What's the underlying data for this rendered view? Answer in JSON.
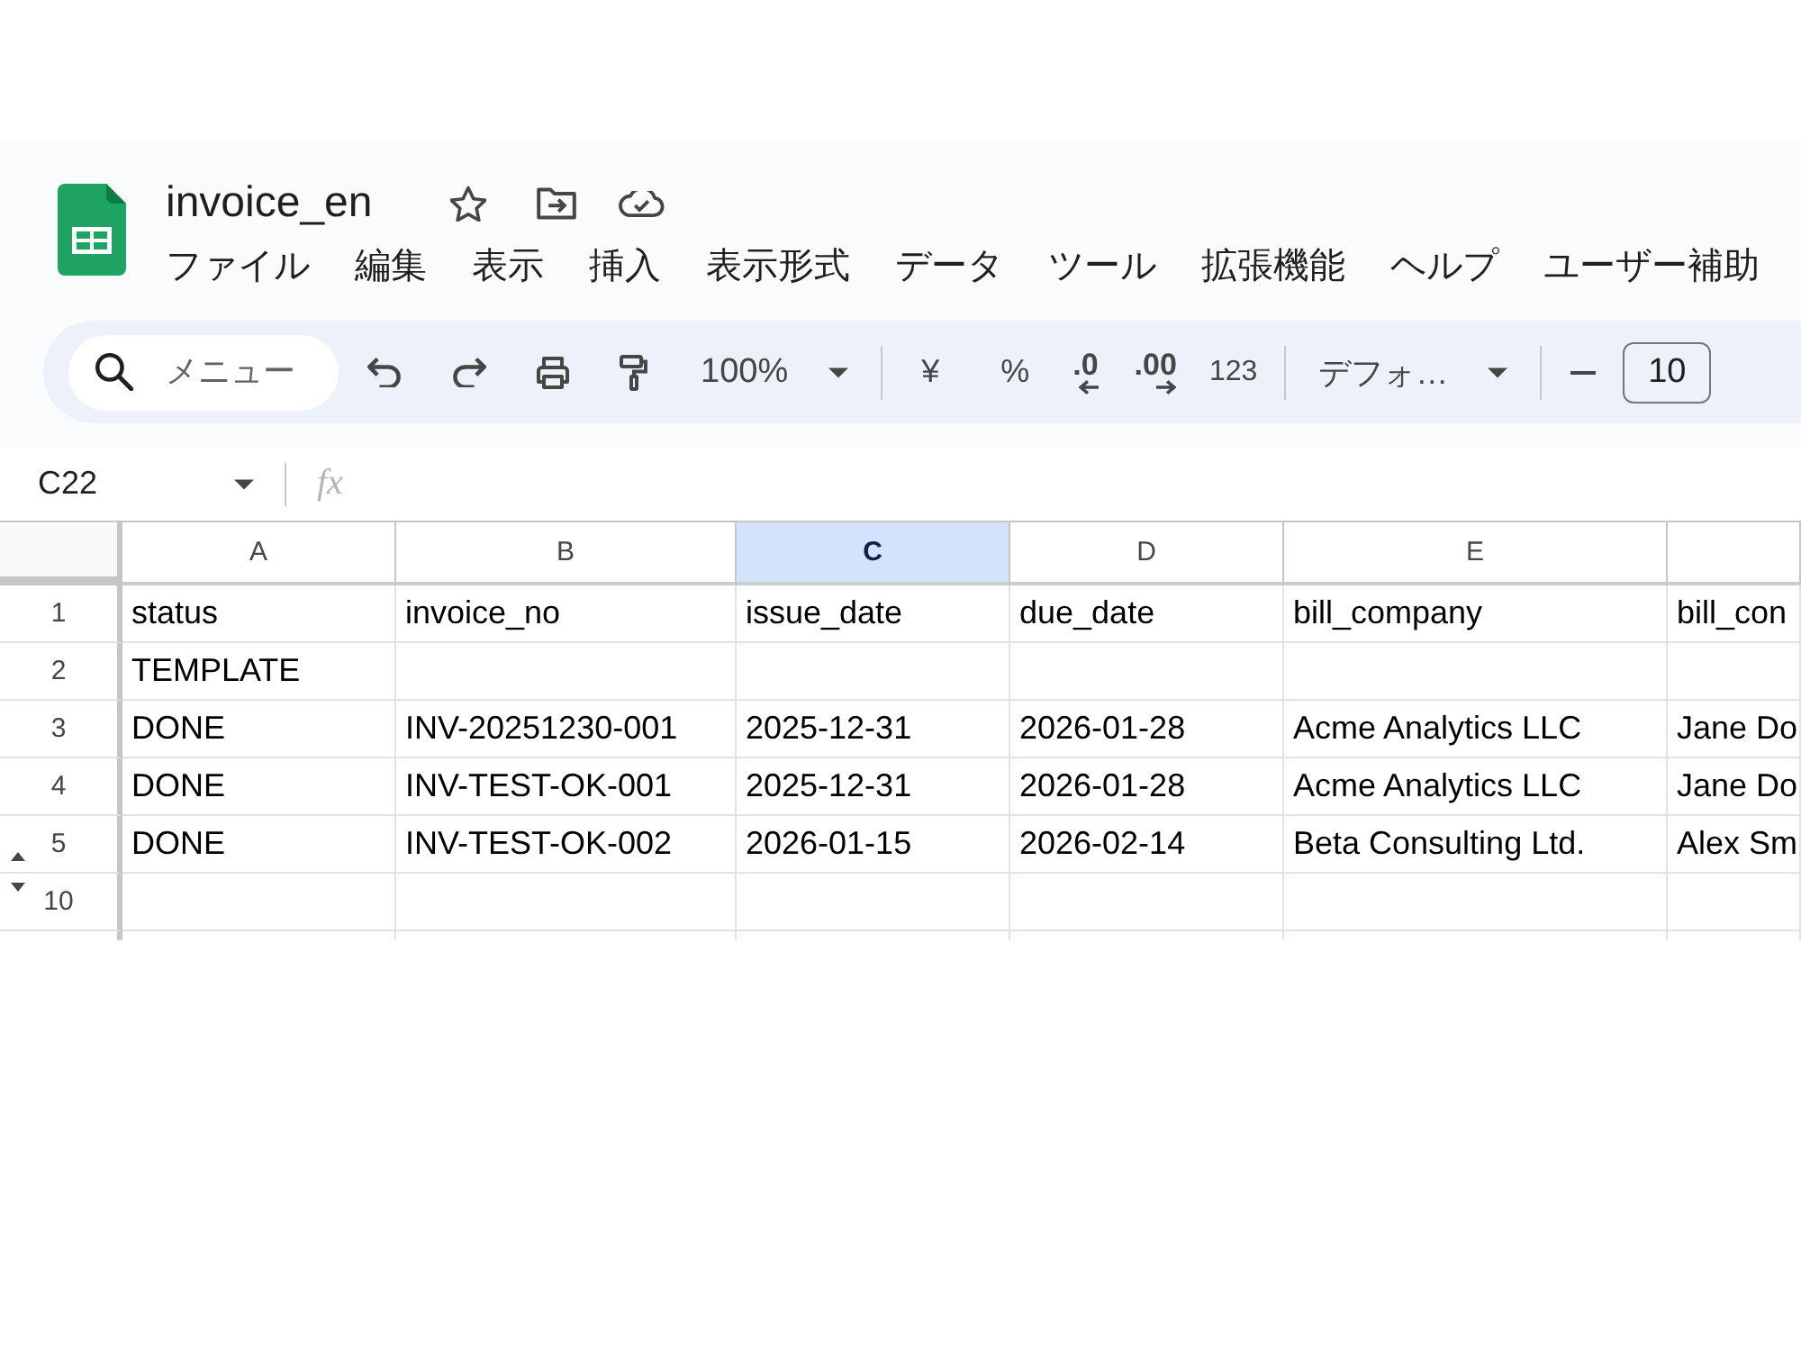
{
  "document": {
    "title": "invoice_en"
  },
  "menu": [
    "ファイル",
    "編集",
    "表示",
    "挿入",
    "表示形式",
    "データ",
    "ツール",
    "拡張機能",
    "ヘルプ",
    "ユーザー補助"
  ],
  "toolbar": {
    "search_placeholder": "メニュー",
    "zoom": "100%",
    "currency": "¥",
    "percent": "%",
    "decrease_decimal": ".0",
    "increase_decimal": ".00",
    "number_format": "123",
    "font": "デフォ…",
    "font_size": "10"
  },
  "formula_bar": {
    "cell_reference": "C22",
    "function_label": "fx"
  },
  "sheet": {
    "columns": [
      {
        "letter": "A",
        "selected": false
      },
      {
        "letter": "B",
        "selected": false
      },
      {
        "letter": "C",
        "selected": true
      },
      {
        "letter": "D",
        "selected": false
      },
      {
        "letter": "E",
        "selected": false
      },
      {
        "selected": false
      }
    ],
    "rows": [
      {
        "number": "1",
        "hidden_rows_above": false,
        "hidden_rows_below": false,
        "cells": [
          "status",
          "invoice_no",
          "issue_date",
          "due_date",
          "bill_company",
          "bill_con"
        ]
      },
      {
        "number": "2",
        "hidden_rows_above": false,
        "hidden_rows_below": false,
        "cells": [
          "TEMPLATE"
        ]
      },
      {
        "number": "3",
        "hidden_rows_above": false,
        "hidden_rows_below": false,
        "cells": [
          "DONE",
          "INV-20251230-001",
          "2025-12-31",
          "2026-01-28",
          "Acme Analytics LLC",
          "Jane Do"
        ]
      },
      {
        "number": "4",
        "hidden_rows_above": false,
        "hidden_rows_below": false,
        "cells": [
          "DONE",
          "INV-TEST-OK-001",
          "2025-12-31",
          "2026-01-28",
          "Acme Analytics LLC",
          "Jane Do"
        ]
      },
      {
        "number": "5",
        "hidden_rows_above": false,
        "hidden_rows_below": true,
        "cells": [
          "DONE",
          "INV-TEST-OK-002",
          "2026-01-15",
          "2026-02-14",
          "Beta Consulting Ltd.",
          "Alex Sm"
        ]
      },
      {
        "number": "10",
        "hidden_rows_above": true,
        "hidden_rows_below": false
      }
    ]
  }
}
